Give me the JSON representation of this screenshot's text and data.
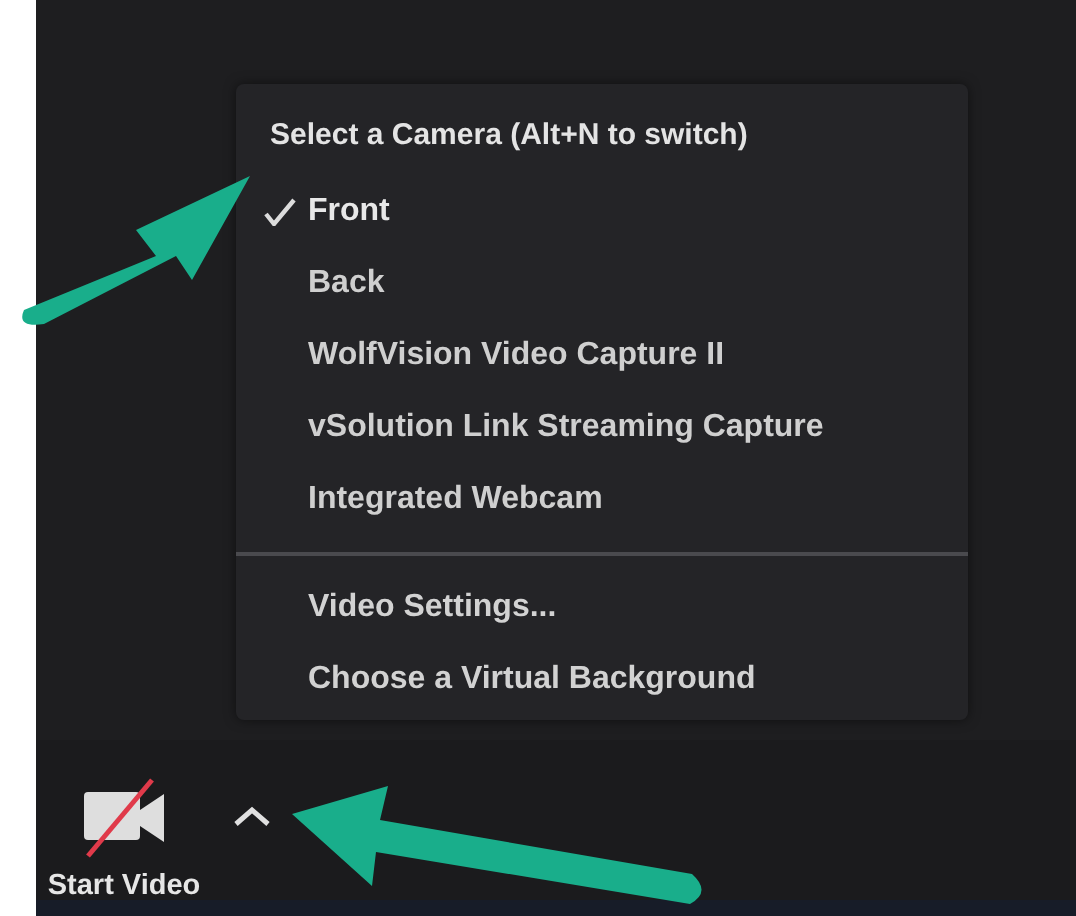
{
  "camera_menu": {
    "heading": "Select a Camera (Alt+N to switch)",
    "cameras": [
      {
        "label": "Front",
        "selected": true
      },
      {
        "label": "Back",
        "selected": false
      },
      {
        "label": "WolfVision Video Capture II",
        "selected": false
      },
      {
        "label": "vSolution Link Streaming Capture",
        "selected": false
      },
      {
        "label": "Integrated Webcam",
        "selected": false
      }
    ],
    "actions": [
      "Video Settings...",
      "Choose a Virtual Background"
    ]
  },
  "toolbar": {
    "video_button": {
      "label": "Start Video",
      "muted": true
    }
  }
}
